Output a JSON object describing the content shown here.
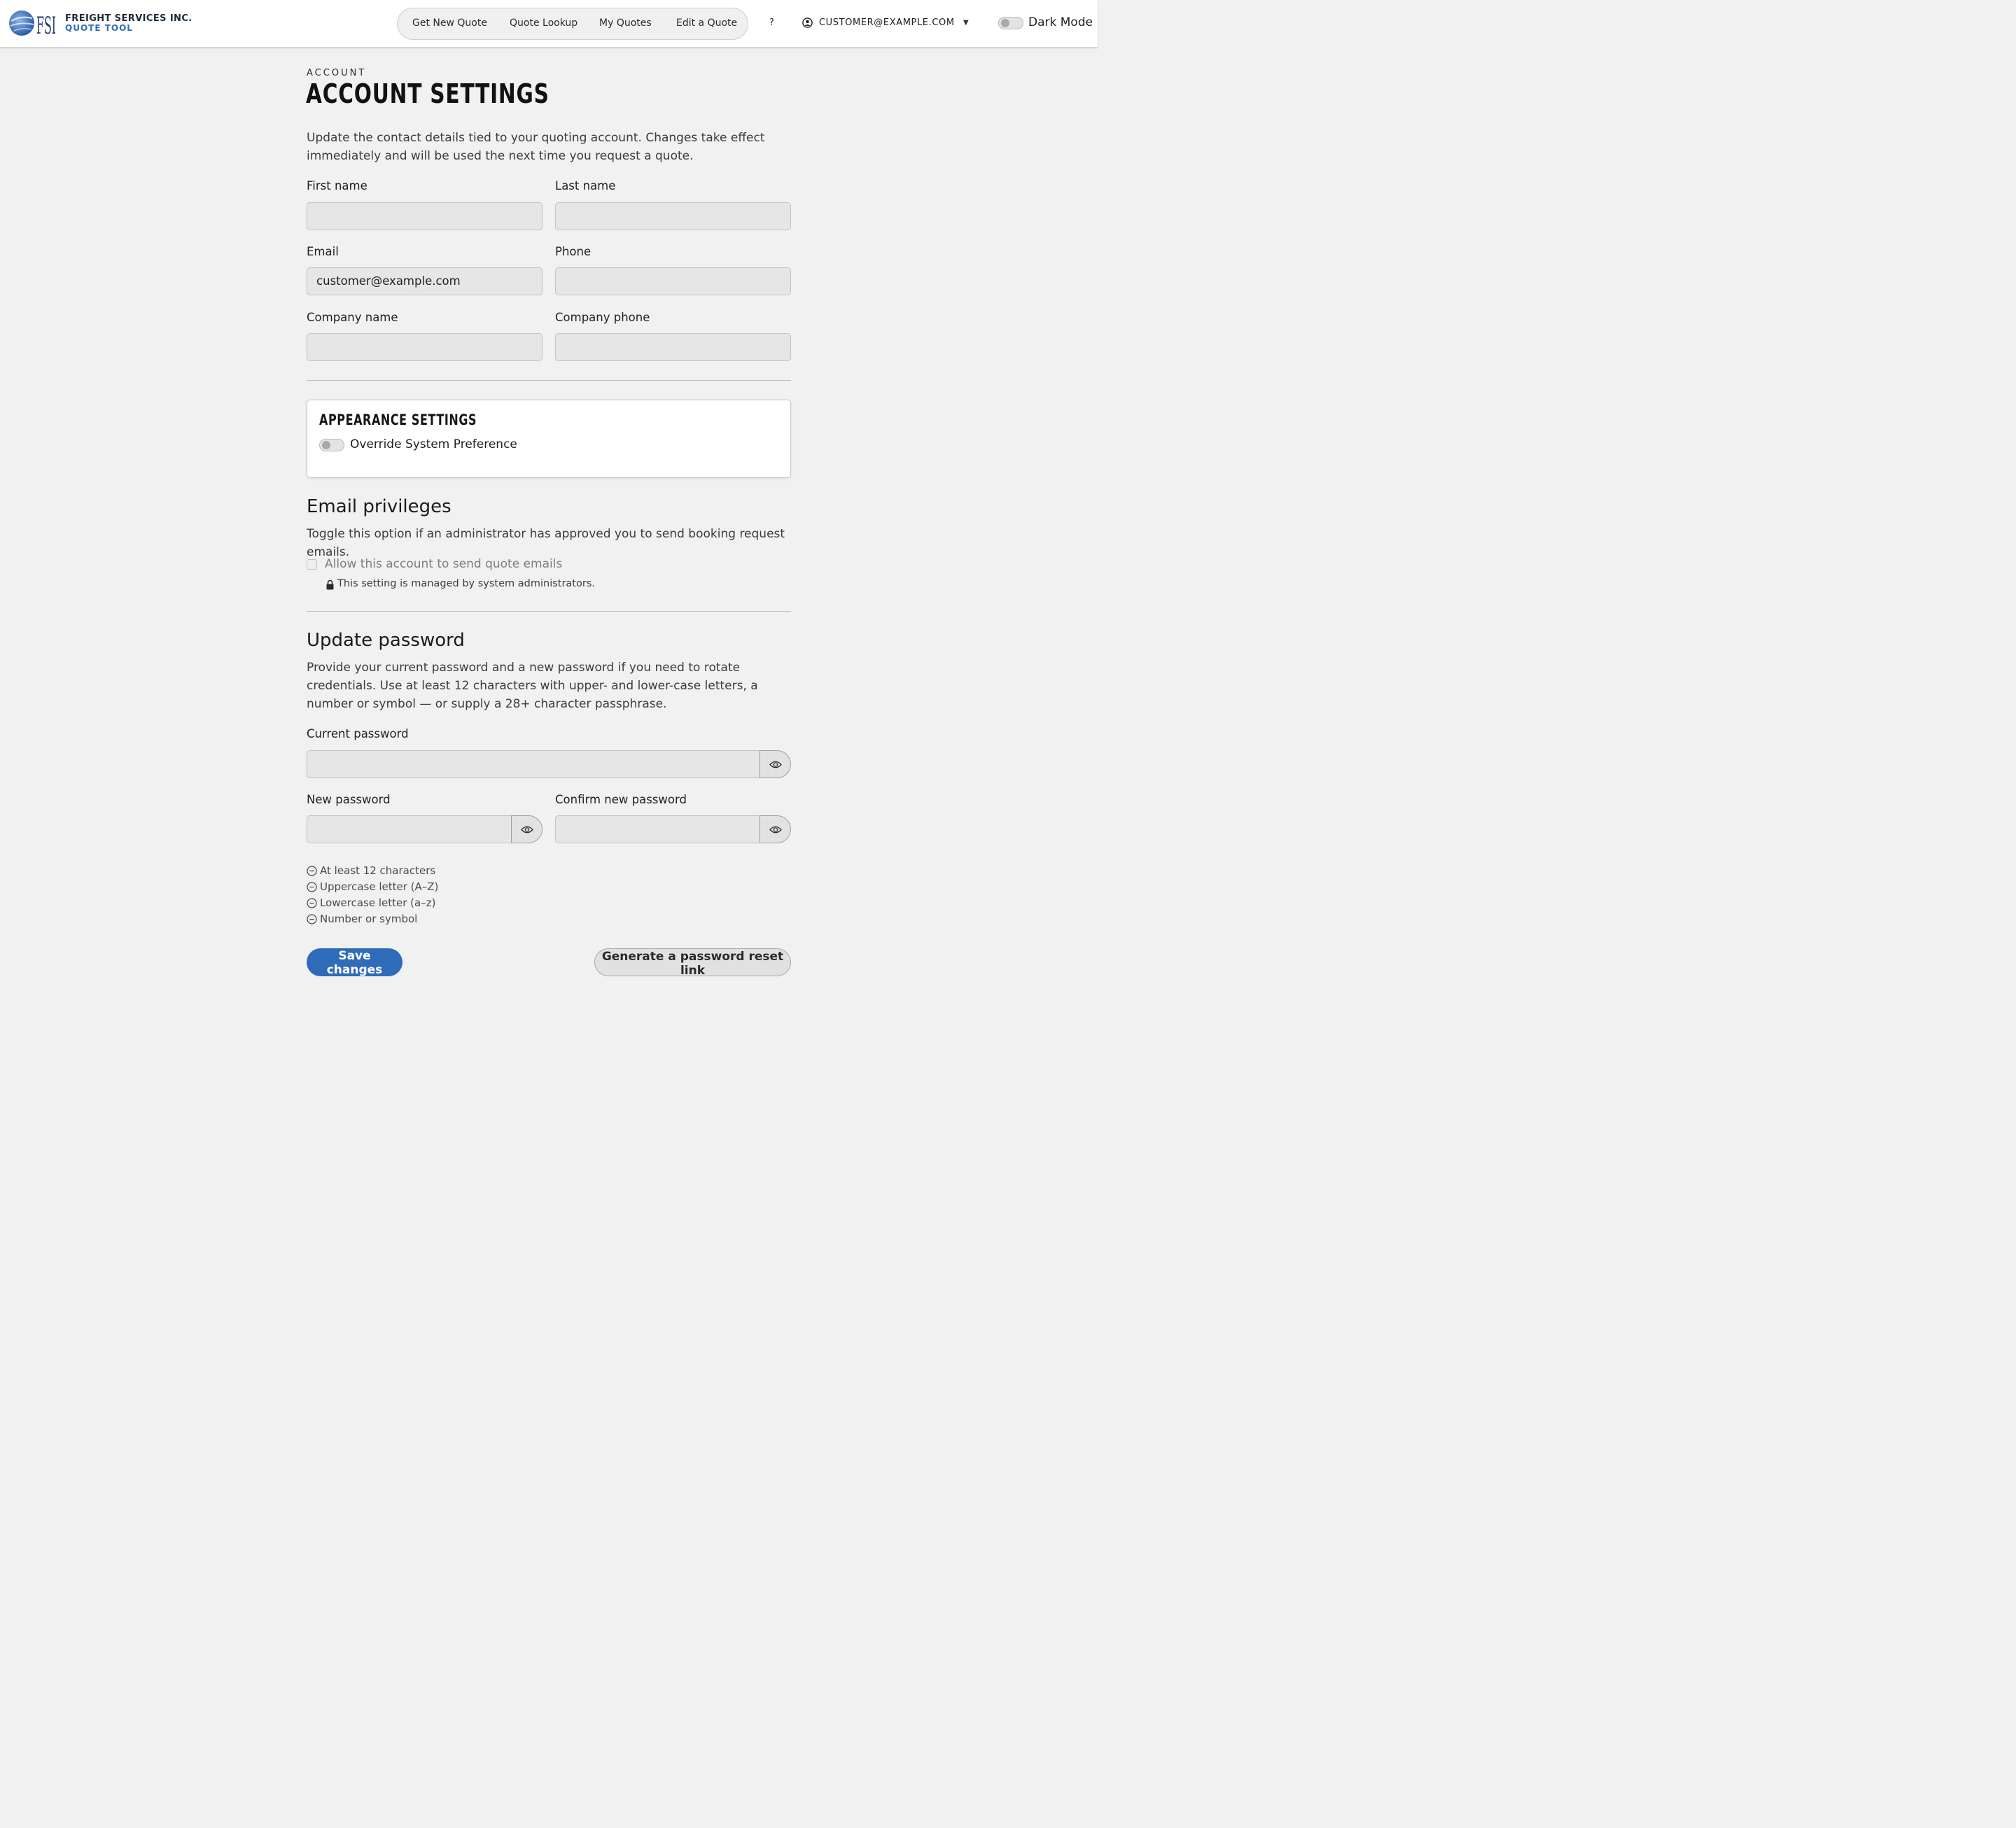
{
  "header": {
    "brand_name": "FREIGHT SERVICES INC.",
    "brand_sub": "QUOTE TOOL",
    "logo_text": "FSI",
    "nav": [
      "Get New Quote",
      "Quote Lookup",
      "My Quotes",
      "Edit a Quote"
    ],
    "help": "?",
    "user_email": "CUSTOMER@EXAMPLE.COM",
    "dark_mode_label": "Dark Mode",
    "dark_mode_on": false
  },
  "page": {
    "eyebrow": "ACCOUNT",
    "title": "ACCOUNT SETTINGS",
    "intro": "Update the contact details tied to your quoting account. Changes take effect immediately and will be used the next time you request a quote."
  },
  "contact": {
    "first_name_label": "First name",
    "first_name_value": "",
    "last_name_label": "Last name",
    "last_name_value": "",
    "email_label": "Email",
    "email_value": "customer@example.com",
    "phone_label": "Phone",
    "phone_value": "",
    "company_name_label": "Company name",
    "company_name_value": "",
    "company_phone_label": "Company phone",
    "company_phone_value": ""
  },
  "appearance": {
    "title": "APPEARANCE SETTINGS",
    "override_label": "Override System Preference",
    "override_on": false
  },
  "email_privileges": {
    "heading": "Email privileges",
    "description": "Toggle this option if an administrator has approved you to send booking request emails.",
    "checkbox_label": "Allow this account to send quote emails",
    "checked": false,
    "note": "This setting is managed by system administrators."
  },
  "password": {
    "heading": "Update password",
    "description": "Provide your current password and a new password if you need to rotate credentials. Use at least 12 characters with upper- and lower-case letters, a number or symbol — or supply a 28+ character passphrase.",
    "current_label": "Current password",
    "new_label": "New password",
    "confirm_label": "Confirm new password",
    "requirements": [
      "At least 12 characters",
      "Uppercase letter (A–Z)",
      "Lowercase letter (a–z)",
      "Number or symbol"
    ]
  },
  "actions": {
    "save": "Save changes",
    "reset": "Generate a password reset link"
  },
  "colors": {
    "primary": "#2e6bb8",
    "page_background": "#f1f1f1",
    "field_background": "#e6e6e6"
  }
}
